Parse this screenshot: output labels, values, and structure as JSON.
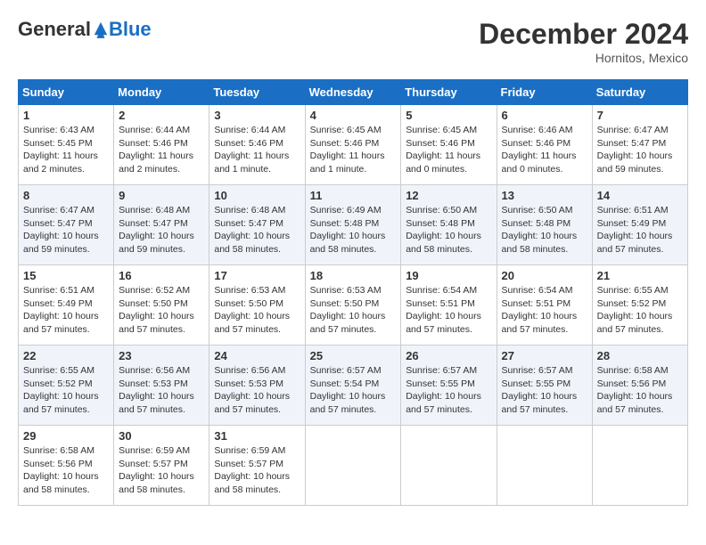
{
  "header": {
    "logo_general": "General",
    "logo_blue": "Blue",
    "month": "December 2024",
    "location": "Hornitos, Mexico"
  },
  "weekdays": [
    "Sunday",
    "Monday",
    "Tuesday",
    "Wednesday",
    "Thursday",
    "Friday",
    "Saturday"
  ],
  "weeks": [
    [
      {
        "day": 1,
        "sunrise": "6:43 AM",
        "sunset": "5:45 PM",
        "daylight": "11 hours and 2 minutes."
      },
      {
        "day": 2,
        "sunrise": "6:44 AM",
        "sunset": "5:46 PM",
        "daylight": "11 hours and 2 minutes."
      },
      {
        "day": 3,
        "sunrise": "6:44 AM",
        "sunset": "5:46 PM",
        "daylight": "11 hours and 1 minute."
      },
      {
        "day": 4,
        "sunrise": "6:45 AM",
        "sunset": "5:46 PM",
        "daylight": "11 hours and 1 minute."
      },
      {
        "day": 5,
        "sunrise": "6:45 AM",
        "sunset": "5:46 PM",
        "daylight": "11 hours and 0 minutes."
      },
      {
        "day": 6,
        "sunrise": "6:46 AM",
        "sunset": "5:46 PM",
        "daylight": "11 hours and 0 minutes."
      },
      {
        "day": 7,
        "sunrise": "6:47 AM",
        "sunset": "5:47 PM",
        "daylight": "10 hours and 59 minutes."
      }
    ],
    [
      {
        "day": 8,
        "sunrise": "6:47 AM",
        "sunset": "5:47 PM",
        "daylight": "10 hours and 59 minutes."
      },
      {
        "day": 9,
        "sunrise": "6:48 AM",
        "sunset": "5:47 PM",
        "daylight": "10 hours and 59 minutes."
      },
      {
        "day": 10,
        "sunrise": "6:48 AM",
        "sunset": "5:47 PM",
        "daylight": "10 hours and 58 minutes."
      },
      {
        "day": 11,
        "sunrise": "6:49 AM",
        "sunset": "5:48 PM",
        "daylight": "10 hours and 58 minutes."
      },
      {
        "day": 12,
        "sunrise": "6:50 AM",
        "sunset": "5:48 PM",
        "daylight": "10 hours and 58 minutes."
      },
      {
        "day": 13,
        "sunrise": "6:50 AM",
        "sunset": "5:48 PM",
        "daylight": "10 hours and 58 minutes."
      },
      {
        "day": 14,
        "sunrise": "6:51 AM",
        "sunset": "5:49 PM",
        "daylight": "10 hours and 57 minutes."
      }
    ],
    [
      {
        "day": 15,
        "sunrise": "6:51 AM",
        "sunset": "5:49 PM",
        "daylight": "10 hours and 57 minutes."
      },
      {
        "day": 16,
        "sunrise": "6:52 AM",
        "sunset": "5:50 PM",
        "daylight": "10 hours and 57 minutes."
      },
      {
        "day": 17,
        "sunrise": "6:53 AM",
        "sunset": "5:50 PM",
        "daylight": "10 hours and 57 minutes."
      },
      {
        "day": 18,
        "sunrise": "6:53 AM",
        "sunset": "5:50 PM",
        "daylight": "10 hours and 57 minutes."
      },
      {
        "day": 19,
        "sunrise": "6:54 AM",
        "sunset": "5:51 PM",
        "daylight": "10 hours and 57 minutes."
      },
      {
        "day": 20,
        "sunrise": "6:54 AM",
        "sunset": "5:51 PM",
        "daylight": "10 hours and 57 minutes."
      },
      {
        "day": 21,
        "sunrise": "6:55 AM",
        "sunset": "5:52 PM",
        "daylight": "10 hours and 57 minutes."
      }
    ],
    [
      {
        "day": 22,
        "sunrise": "6:55 AM",
        "sunset": "5:52 PM",
        "daylight": "10 hours and 57 minutes."
      },
      {
        "day": 23,
        "sunrise": "6:56 AM",
        "sunset": "5:53 PM",
        "daylight": "10 hours and 57 minutes."
      },
      {
        "day": 24,
        "sunrise": "6:56 AM",
        "sunset": "5:53 PM",
        "daylight": "10 hours and 57 minutes."
      },
      {
        "day": 25,
        "sunrise": "6:57 AM",
        "sunset": "5:54 PM",
        "daylight": "10 hours and 57 minutes."
      },
      {
        "day": 26,
        "sunrise": "6:57 AM",
        "sunset": "5:55 PM",
        "daylight": "10 hours and 57 minutes."
      },
      {
        "day": 27,
        "sunrise": "6:57 AM",
        "sunset": "5:55 PM",
        "daylight": "10 hours and 57 minutes."
      },
      {
        "day": 28,
        "sunrise": "6:58 AM",
        "sunset": "5:56 PM",
        "daylight": "10 hours and 57 minutes."
      }
    ],
    [
      {
        "day": 29,
        "sunrise": "6:58 AM",
        "sunset": "5:56 PM",
        "daylight": "10 hours and 58 minutes."
      },
      {
        "day": 30,
        "sunrise": "6:59 AM",
        "sunset": "5:57 PM",
        "daylight": "10 hours and 58 minutes."
      },
      {
        "day": 31,
        "sunrise": "6:59 AM",
        "sunset": "5:57 PM",
        "daylight": "10 hours and 58 minutes."
      },
      null,
      null,
      null,
      null
    ]
  ]
}
